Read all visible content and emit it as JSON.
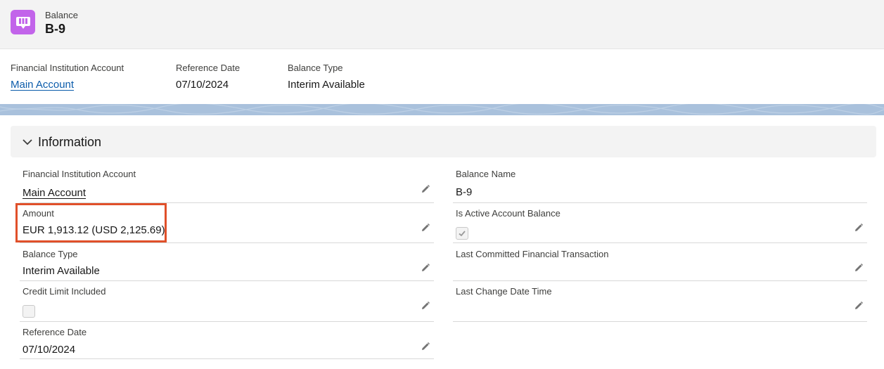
{
  "header": {
    "object_type": "Balance",
    "record_name": "B-9",
    "icon": "balance-book-icon",
    "icon_color": "#c264ea"
  },
  "highlights": {
    "financial_institution_account": {
      "label": "Financial Institution Account",
      "value": "Main Account"
    },
    "reference_date": {
      "label": "Reference Date",
      "value": "07/10/2024"
    },
    "balance_type": {
      "label": "Balance Type",
      "value": "Interim Available"
    }
  },
  "section": {
    "title": "Information",
    "left": {
      "financial_institution_account": {
        "label": "Financial Institution Account",
        "value": "Main Account"
      },
      "amount": {
        "label": "Amount",
        "value": "EUR 1,913.12 (USD 2,125.69)"
      },
      "balance_type": {
        "label": "Balance Type",
        "value": "Interim Available"
      },
      "credit_limit_included": {
        "label": "Credit Limit Included",
        "checked": false
      },
      "reference_date": {
        "label": "Reference Date",
        "value": "07/10/2024"
      }
    },
    "right": {
      "balance_name": {
        "label": "Balance Name",
        "value": "B-9"
      },
      "is_active_account_balance": {
        "label": "Is Active Account Balance",
        "checked": true
      },
      "last_committed_financial_transaction": {
        "label": "Last Committed Financial Transaction",
        "value": ""
      },
      "last_change_date_time": {
        "label": "Last Change Date Time",
        "value": ""
      }
    }
  },
  "colors": {
    "link": "#0b5cab",
    "highlight_border": "#e0502a",
    "band": "#a9c1dc"
  }
}
